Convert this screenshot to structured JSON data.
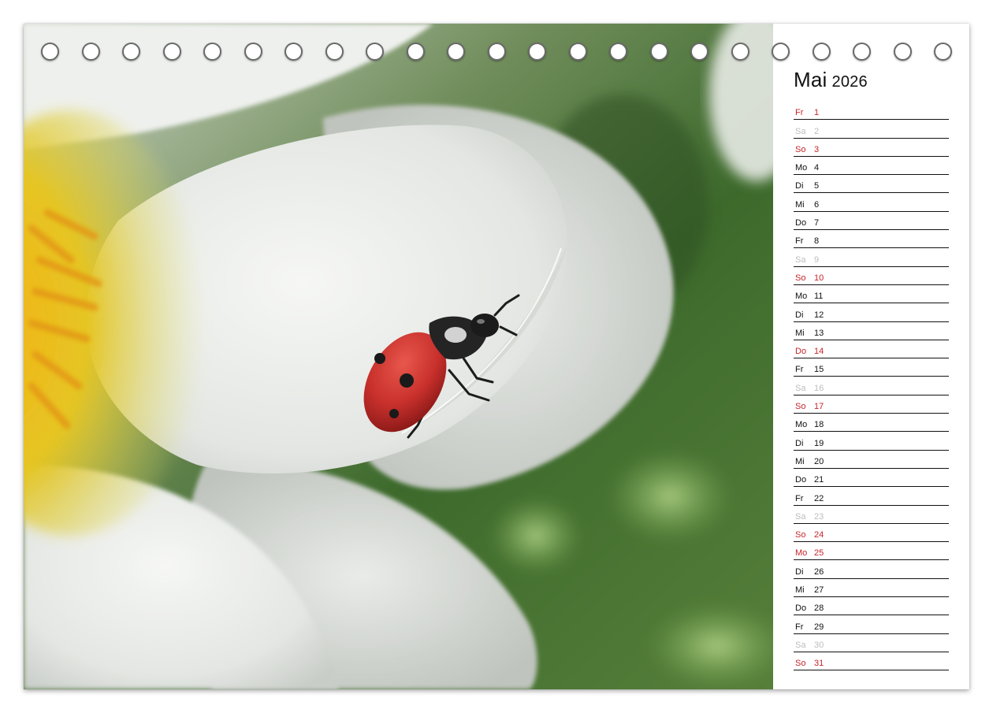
{
  "calendar": {
    "month": "Mai",
    "year": "2026",
    "days": [
      {
        "wd": "Fr",
        "num": "1",
        "kind": "sun"
      },
      {
        "wd": "Sa",
        "num": "2",
        "kind": "sat"
      },
      {
        "wd": "So",
        "num": "3",
        "kind": "sun"
      },
      {
        "wd": "Mo",
        "num": "4",
        "kind": "work"
      },
      {
        "wd": "Di",
        "num": "5",
        "kind": "work"
      },
      {
        "wd": "Mi",
        "num": "6",
        "kind": "work"
      },
      {
        "wd": "Do",
        "num": "7",
        "kind": "work"
      },
      {
        "wd": "Fr",
        "num": "8",
        "kind": "work"
      },
      {
        "wd": "Sa",
        "num": "9",
        "kind": "sat"
      },
      {
        "wd": "So",
        "num": "10",
        "kind": "sun"
      },
      {
        "wd": "Mo",
        "num": "11",
        "kind": "work"
      },
      {
        "wd": "Di",
        "num": "12",
        "kind": "work"
      },
      {
        "wd": "Mi",
        "num": "13",
        "kind": "work"
      },
      {
        "wd": "Do",
        "num": "14",
        "kind": "sun"
      },
      {
        "wd": "Fr",
        "num": "15",
        "kind": "work"
      },
      {
        "wd": "Sa",
        "num": "16",
        "kind": "sat"
      },
      {
        "wd": "So",
        "num": "17",
        "kind": "sun"
      },
      {
        "wd": "Mo",
        "num": "18",
        "kind": "work"
      },
      {
        "wd": "Di",
        "num": "19",
        "kind": "work"
      },
      {
        "wd": "Mi",
        "num": "20",
        "kind": "work"
      },
      {
        "wd": "Do",
        "num": "21",
        "kind": "work"
      },
      {
        "wd": "Fr",
        "num": "22",
        "kind": "work"
      },
      {
        "wd": "Sa",
        "num": "23",
        "kind": "sat"
      },
      {
        "wd": "So",
        "num": "24",
        "kind": "sun"
      },
      {
        "wd": "Mo",
        "num": "25",
        "kind": "sun"
      },
      {
        "wd": "Di",
        "num": "26",
        "kind": "work"
      },
      {
        "wd": "Mi",
        "num": "27",
        "kind": "work"
      },
      {
        "wd": "Do",
        "num": "28",
        "kind": "work"
      },
      {
        "wd": "Fr",
        "num": "29",
        "kind": "work"
      },
      {
        "wd": "Sa",
        "num": "30",
        "kind": "sat"
      },
      {
        "wd": "So",
        "num": "31",
        "kind": "sun"
      }
    ]
  },
  "colors": {
    "holiday_red": "#c8242a",
    "saturday_grey": "#bdbdbd",
    "ladybug_red": "#c8302c"
  },
  "binding": {
    "ring_count": 23
  }
}
